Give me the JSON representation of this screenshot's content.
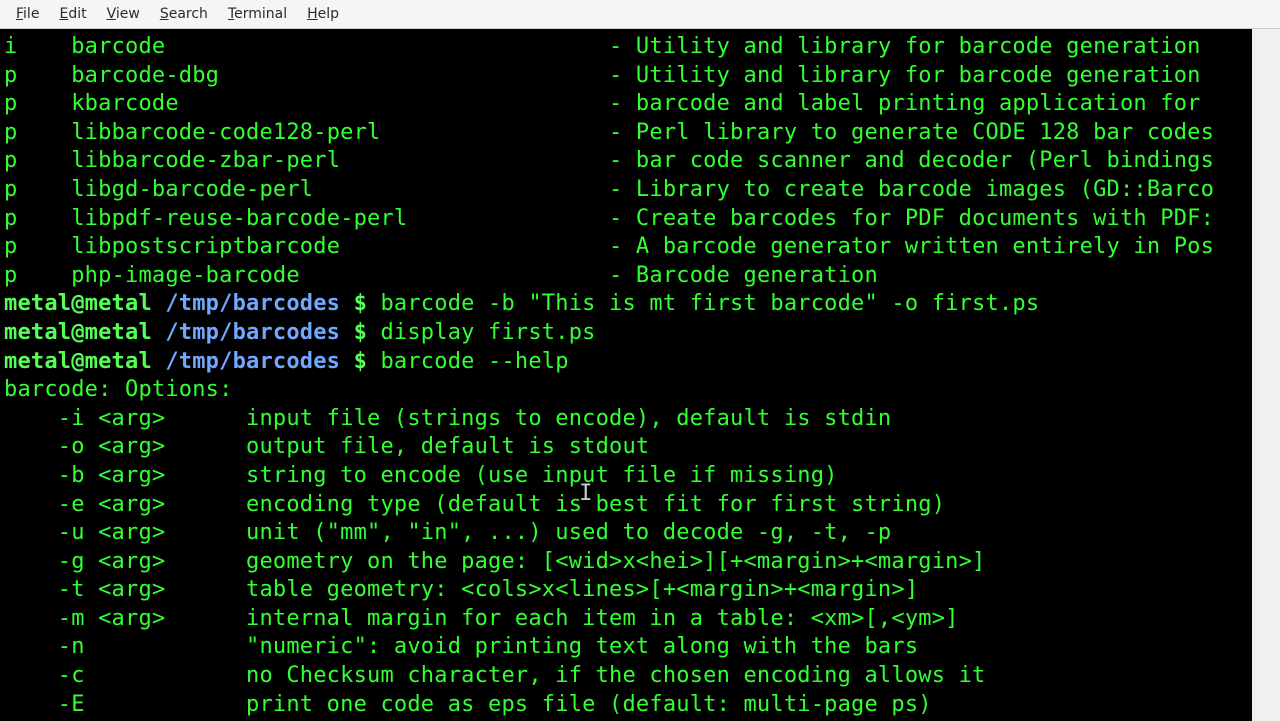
{
  "menubar": {
    "file": {
      "hot": "F",
      "rest": "ile"
    },
    "edit": {
      "hot": "E",
      "rest": "dit"
    },
    "view": {
      "hot": "V",
      "rest": "iew"
    },
    "search": {
      "hot": "S",
      "rest": "earch"
    },
    "terminal": {
      "hot": "T",
      "rest": "erminal"
    },
    "help": {
      "hot": "H",
      "rest": "elp"
    }
  },
  "packages": [
    {
      "st": "i",
      "name": "barcode",
      "desc": "- Utility and library for barcode generation"
    },
    {
      "st": "p",
      "name": "barcode-dbg",
      "desc": "- Utility and library for barcode generation"
    },
    {
      "st": "p",
      "name": "kbarcode",
      "desc": "- barcode and label printing application for"
    },
    {
      "st": "p",
      "name": "libbarcode-code128-perl",
      "desc": "- Perl library to generate CODE 128 bar codes"
    },
    {
      "st": "p",
      "name": "libbarcode-zbar-perl",
      "desc": "- bar code scanner and decoder (Perl bindings"
    },
    {
      "st": "p",
      "name": "libgd-barcode-perl",
      "desc": "- Library to create barcode images (GD::Barco"
    },
    {
      "st": "p",
      "name": "libpdf-reuse-barcode-perl",
      "desc": "- Create barcodes for PDF documents with PDF:"
    },
    {
      "st": "p",
      "name": "libpostscriptbarcode",
      "desc": "- A barcode generator written entirely in Pos"
    },
    {
      "st": "p",
      "name": "php-image-barcode",
      "desc": "- Barcode generation"
    }
  ],
  "prompt": {
    "userhost": "metal@metal",
    "path": "/tmp/barcodes",
    "sigil": "$"
  },
  "cmd1": "barcode -b \"This is mt first barcode\" -o first.ps",
  "cmd2": "display first.ps",
  "cmd3": "barcode --help",
  "help_header": "barcode: Options:",
  "help_opts": [
    {
      "flag": "-i <arg>",
      "desc": "input file (strings to encode), default is stdin"
    },
    {
      "flag": "-o <arg>",
      "desc": "output file, default is stdout"
    },
    {
      "flag": "-b <arg>",
      "desc": "string to encode (use input file if missing)",
      "cursor_after": "string to encode (use inp",
      "cursor_rest": "t file if missing)"
    },
    {
      "flag": "-e <arg>",
      "desc": "encoding type (default is best fit for first string)"
    },
    {
      "flag": "-u <arg>",
      "desc": "unit (\"mm\", \"in\", ...) used to decode -g, -t, -p"
    },
    {
      "flag": "-g <arg>",
      "desc": "geometry on the page: [<wid>x<hei>][+<margin>+<margin>]"
    },
    {
      "flag": "-t <arg>",
      "desc": "table geometry: <cols>x<lines>[+<margin>+<margin>]"
    },
    {
      "flag": "-m <arg>",
      "desc": "internal margin for each item in a table: <xm>[,<ym>]"
    },
    {
      "flag": "-n      ",
      "desc": "\"numeric\": avoid printing text along with the bars"
    },
    {
      "flag": "-c      ",
      "desc": "no Checksum character, if the chosen encoding allows it"
    },
    {
      "flag": "-E      ",
      "desc": "print one code as eps file (default: multi-page ps)"
    }
  ],
  "spacer_pkg_name_width": 40,
  "spacer_flag_left_pad": "    ",
  "spacer_flag_mid_pad": "      "
}
